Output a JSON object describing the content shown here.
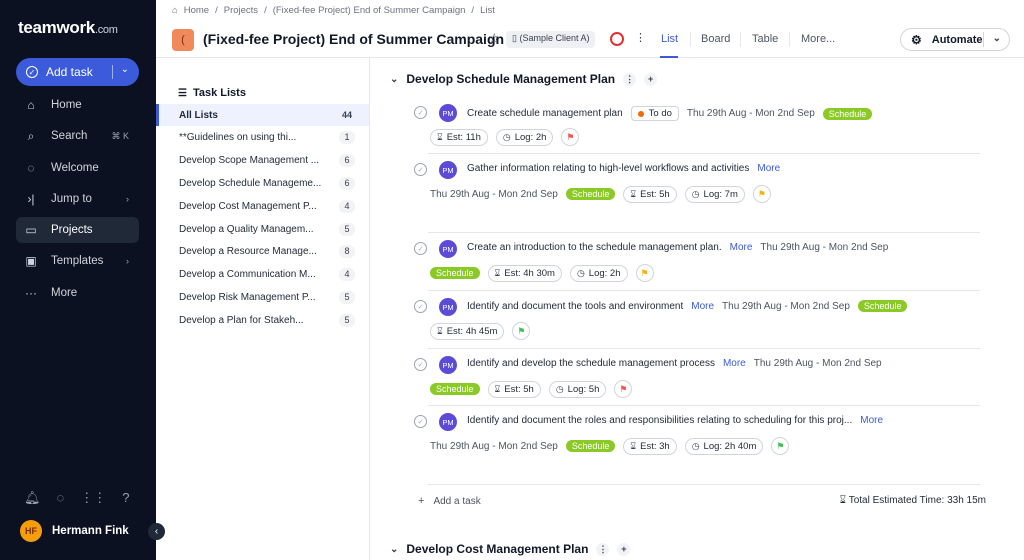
{
  "app": {
    "logo": "teamwork",
    "logo_suffix": ".com"
  },
  "sidebar": {
    "add_task_label": "Add task",
    "items": [
      {
        "label": "Home",
        "icon": "home-icon",
        "glyph": "⌂",
        "right": ""
      },
      {
        "label": "Search",
        "icon": "search-icon",
        "glyph": "⌕",
        "right": "⌘ K"
      },
      {
        "label": "Welcome",
        "icon": "welcome-icon",
        "glyph": "◌",
        "right": ""
      },
      {
        "label": "Jump to",
        "icon": "jump-to-icon",
        "glyph": "›|",
        "right": "›"
      },
      {
        "label": "Projects",
        "icon": "folder-icon",
        "glyph": "▭",
        "right": ""
      },
      {
        "label": "Templates",
        "icon": "templates-icon",
        "glyph": "▣",
        "right": "›"
      },
      {
        "label": "More",
        "icon": "more-icon",
        "glyph": "···",
        "right": ""
      }
    ],
    "user_name": "Hermann Fink"
  },
  "breadcrumb": [
    "Home",
    "Projects",
    "(Fixed-fee Project) End of Summer Campaign",
    "List"
  ],
  "header": {
    "project_icon_text": "(",
    "title": "(Fixed-fee Project) End of Summer Campaign",
    "client": "(Sample Client A)",
    "tabs": [
      "List",
      "Board",
      "Table",
      "More..."
    ],
    "automate_label": "Automate"
  },
  "task_lists": {
    "heading": "Task Lists",
    "items": [
      {
        "name": "All Lists",
        "count": "44"
      },
      {
        "name": "**Guidelines on using thi...",
        "count": "1"
      },
      {
        "name": "Develop Scope Management ...",
        "count": "6"
      },
      {
        "name": "Develop Schedule Manageme...",
        "count": "6"
      },
      {
        "name": "Develop Cost Management P...",
        "count": "4"
      },
      {
        "name": "Develop a Quality Managem...",
        "count": "5"
      },
      {
        "name": "Develop a Resource Manage...",
        "count": "8"
      },
      {
        "name": "Develop a Communication M...",
        "count": "4"
      },
      {
        "name": "Develop Risk Management P...",
        "count": "5"
      },
      {
        "name": "Develop a Plan for Stakeh...",
        "count": "5"
      }
    ]
  },
  "group1": {
    "title": "Develop Schedule Management Plan",
    "add_task": "Add a task",
    "total": "Total Estimated Time: 33h 15m",
    "tasks": [
      {
        "avatar": "PM",
        "name": "Create schedule management plan",
        "more": "",
        "status": "To do",
        "date": "Thu 29th Aug - Mon 2nd Sep",
        "tag": "Schedule",
        "est": "Est: 11h",
        "log": "Log: 2h",
        "flag_color": "#fa5252"
      },
      {
        "avatar": "PM",
        "name": "Gather information relating to high-level workflows and activities",
        "more": "More",
        "status": "",
        "date": "Thu 29th Aug - Mon 2nd Sep",
        "tag": "Schedule",
        "est": "Est: 5h",
        "log": "Log: 7m",
        "flag_color": "#fab005"
      },
      {
        "avatar": "PM",
        "name": "Create an introduction to the schedule management plan.",
        "more": "More",
        "status": "",
        "date": "Thu 29th Aug - Mon 2nd Sep",
        "tag": "Schedule",
        "est": "Est: 4h 30m",
        "log": "Log: 2h",
        "flag_color": "#fab005"
      },
      {
        "avatar": "PM",
        "name": "Identify and document the tools and environment",
        "more": "More",
        "status": "",
        "date": "Thu 29th Aug - Mon 2nd Sep",
        "tag": "Schedule",
        "est": "Est: 4h 45m",
        "log": "",
        "flag_color": "#40c057"
      },
      {
        "avatar": "PM",
        "name": "Identify and develop the schedule management process",
        "more": "More",
        "status": "",
        "date": "Thu 29th Aug - Mon 2nd Sep",
        "tag": "Schedule",
        "est": "Est: 5h",
        "log": "Log: 5h",
        "flag_color": "#fa5252"
      },
      {
        "avatar": "PM",
        "name": "Identify and document the roles and responsibilities relating to scheduling for this proj...",
        "more": "More",
        "status": "",
        "date": "Thu 29th Aug - Mon 2nd Sep",
        "tag": "Schedule",
        "est": "Est: 3h",
        "log": "Log: 2h 40m",
        "flag_color": "#40c057"
      }
    ]
  },
  "group2": {
    "title": "Develop Cost Management Plan"
  }
}
